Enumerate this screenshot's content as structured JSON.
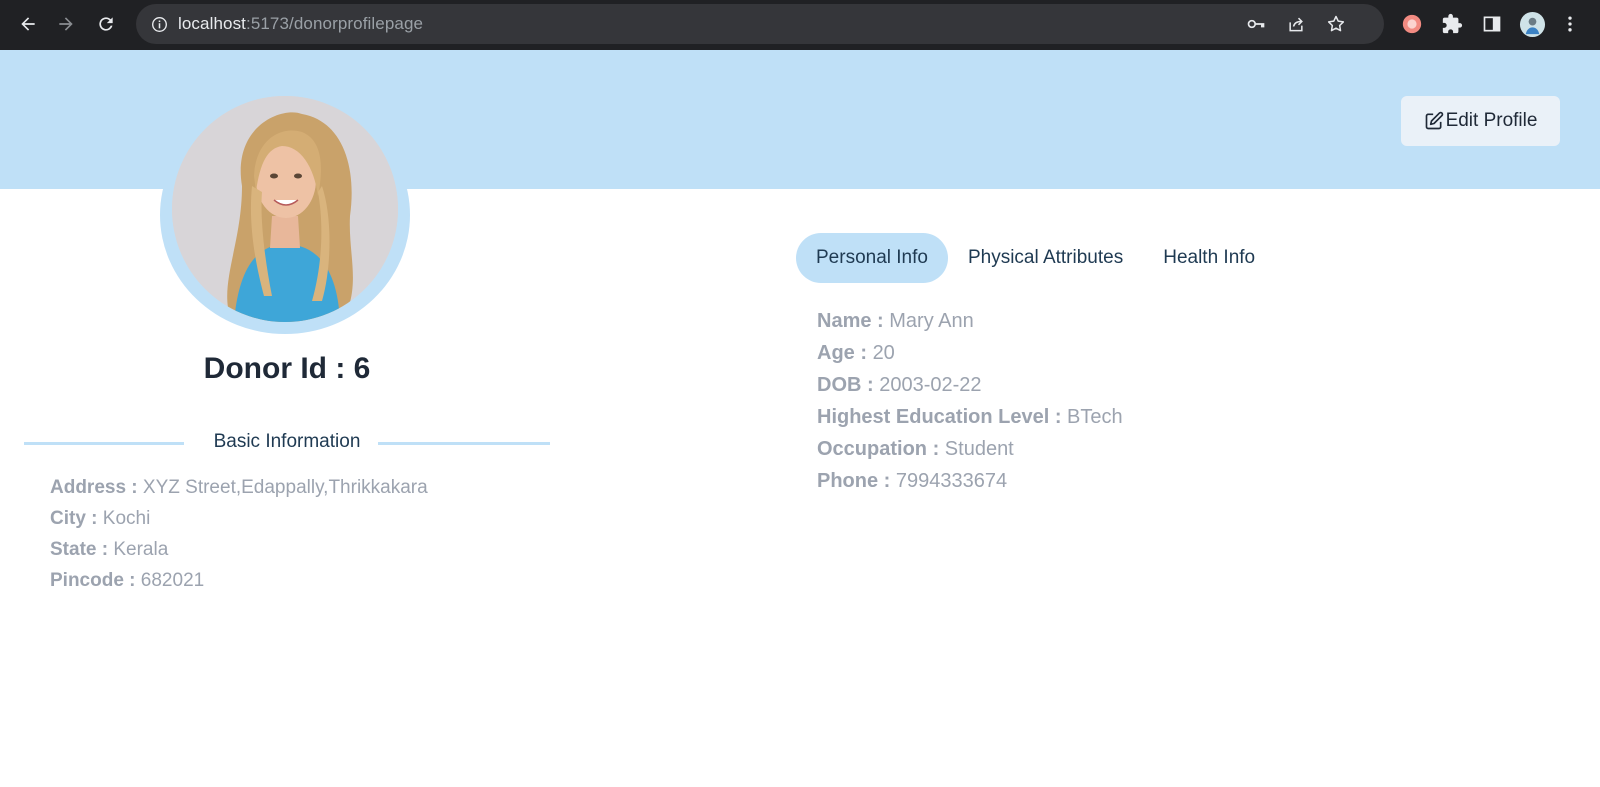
{
  "browser": {
    "url_host": "localhost",
    "url_path": ":5173/donorprofilepage",
    "icons": [
      "back-arrow-icon",
      "forward-arrow-icon",
      "reload-icon",
      "info-icon",
      "key-icon",
      "share-icon",
      "star-icon",
      "extension-circle-icon",
      "puzzle-icon",
      "side-panel-icon",
      "profile-avatar-icon",
      "more-vert-icon"
    ]
  },
  "header": {
    "edit_label": "Edit Profile",
    "banner_color": "#bfe0f7"
  },
  "profile": {
    "donor_id": "Donor Id : 6"
  },
  "basic": {
    "heading": "Basic Information",
    "rows": [
      {
        "key": "Address :",
        "value": "XYZ Street,Edappally,Thrikkakara"
      },
      {
        "key": "City :",
        "value": "Kochi"
      },
      {
        "key": "State :",
        "value": "Kerala"
      },
      {
        "key": "Pincode :",
        "value": "682021"
      }
    ]
  },
  "tabs": [
    {
      "label": "Personal Info",
      "active": true
    },
    {
      "label": "Physical Attributes",
      "active": false
    },
    {
      "label": "Health Info",
      "active": false
    }
  ],
  "personal": {
    "rows": [
      {
        "key": "Name :",
        "value": "Mary Ann"
      },
      {
        "key": "Age :",
        "value": "20"
      },
      {
        "key": "DOB :",
        "value": "2003-02-22"
      },
      {
        "key": "Highest Education Level :",
        "value": "BTech"
      },
      {
        "key": "Occupation :",
        "value": "Student"
      },
      {
        "key": "Phone :",
        "value": "7994333674"
      }
    ]
  }
}
